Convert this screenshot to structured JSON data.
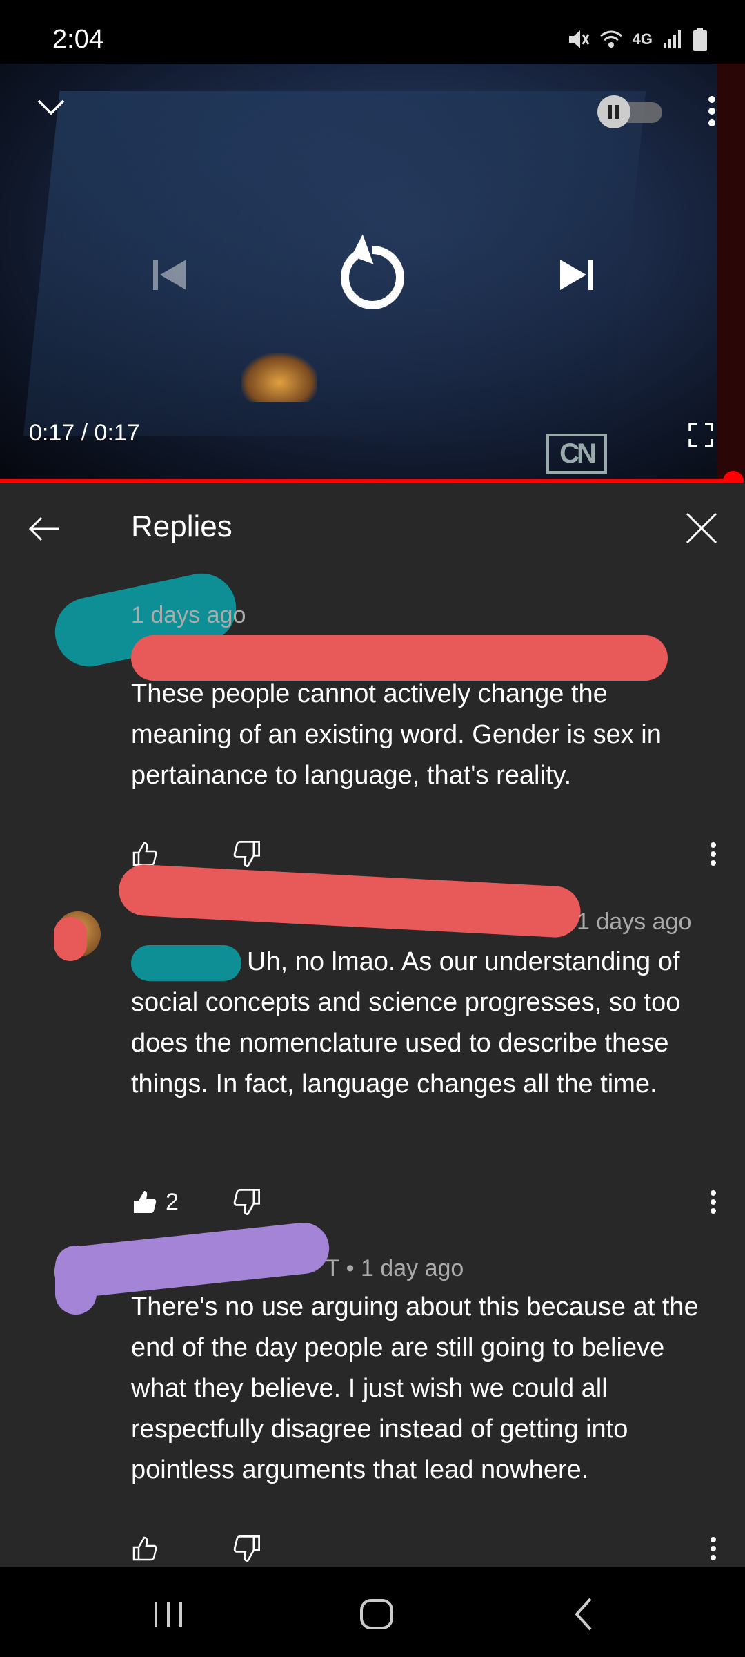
{
  "status_bar": {
    "time": "2:04",
    "icons": [
      "mute-icon",
      "wifi-icon",
      "4g-icon",
      "signal-icon",
      "battery-icon"
    ]
  },
  "player": {
    "current_time": "0:17",
    "duration": "0:17",
    "separator": " / ",
    "progress": 1.0,
    "accent_color": "#ff0000",
    "watermark": "CN"
  },
  "replies": {
    "title": "Replies",
    "comments": [
      {
        "meta": "1 days ago",
        "text": "These people cannot actively change the meaning of an existing word. Gender is sex in pertainance to language, that's reality.",
        "likes": ""
      },
      {
        "meta": "1 days ago",
        "text": "Uh, no lmao. As our understanding of social concepts and science progresses, so too does the nomenclature used to describe these things. In fact, language changes all the time.",
        "likes": "2"
      },
      {
        "meta": "T • 1 day ago",
        "text": "There's no use arguing about this because at the end of the day people are still going to believe what they believe. I just wish we could all respectfully disagree instead of getting into pointless arguments that lead nowhere.",
        "likes": ""
      }
    ]
  },
  "colors": {
    "redaction_teal": "#0e8f95",
    "redaction_red": "#e85a5a",
    "redaction_purple": "#a484d6"
  }
}
